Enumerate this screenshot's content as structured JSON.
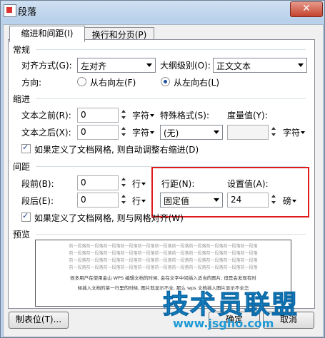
{
  "window": {
    "title": "段落",
    "close_glyph": "✕"
  },
  "tabs": [
    {
      "label": "缩进和间距(I)"
    },
    {
      "label": "换行和分页(P)"
    }
  ],
  "general": {
    "heading": "常规",
    "alignment_label": "对齐方式(G):",
    "alignment_value": "左对齐",
    "outline_label": "大纲级别(O):",
    "outline_value": "正文文本",
    "direction_label": "方向:",
    "rtl_label": "从右向左(F)",
    "ltr_label": "从左向右(L)"
  },
  "indent": {
    "heading": "缩进",
    "before_label": "文本之前(R):",
    "before_value": "0",
    "before_unit": "字符",
    "after_label": "文本之后(X):",
    "after_value": "0",
    "after_unit": "字符",
    "special_label": "特殊格式(S):",
    "special_value": "(无)",
    "measure_label": "度量值(Y):",
    "measure_value": "",
    "measure_unit": "字符",
    "grid_check_label": "如果定义了文档网格, 则自动调整右缩进(D)"
  },
  "spacing": {
    "heading": "间距",
    "before_label": "段前(B):",
    "before_value": "0",
    "before_unit": "行",
    "after_label": "段后(E):",
    "after_value": "0",
    "after_unit": "行",
    "line_label": "行距(N):",
    "line_value": "固定值",
    "set_label": "设置值(A):",
    "set_value": "24",
    "set_unit": "磅",
    "grid_check_label": "如果定义了文档网格, 则与网格对齐(W)"
  },
  "preview": {
    "heading": "预览",
    "lines": [
      "前一段落前一段落前一段落前一段落前一段落前一段落前一段落前一段落前一段落前一段落前一段落",
      "前一段落前一段落前一段落前一段落前一段落前一段落前一段落前一段落前一段落前一段落前一段落",
      "前一段落前一段落前一段落前一段落前一段落前一段落前一段落前一段落前一段落前一段落前一段落",
      "前一段落前一段落前一段落前一段落前一段落前一段落前一段落前一段落前一段落前一段落前一段落",
      "很多用户在使用金山 WPS 编辑文档的时候, 会在文字中间插入适当的图片, 但是会发现有时",
      "候插入文档的某一行里的时候, 图片就显示不全, 那么 wps 文档插入图片显示不全怎"
    ]
  },
  "buttons": {
    "tabs_label": "制表位(T)...",
    "ok_label": "确定",
    "cancel_label": "取消"
  },
  "watermark": {
    "text": "技术员联盟",
    "url": "www.jsgho.com"
  }
}
